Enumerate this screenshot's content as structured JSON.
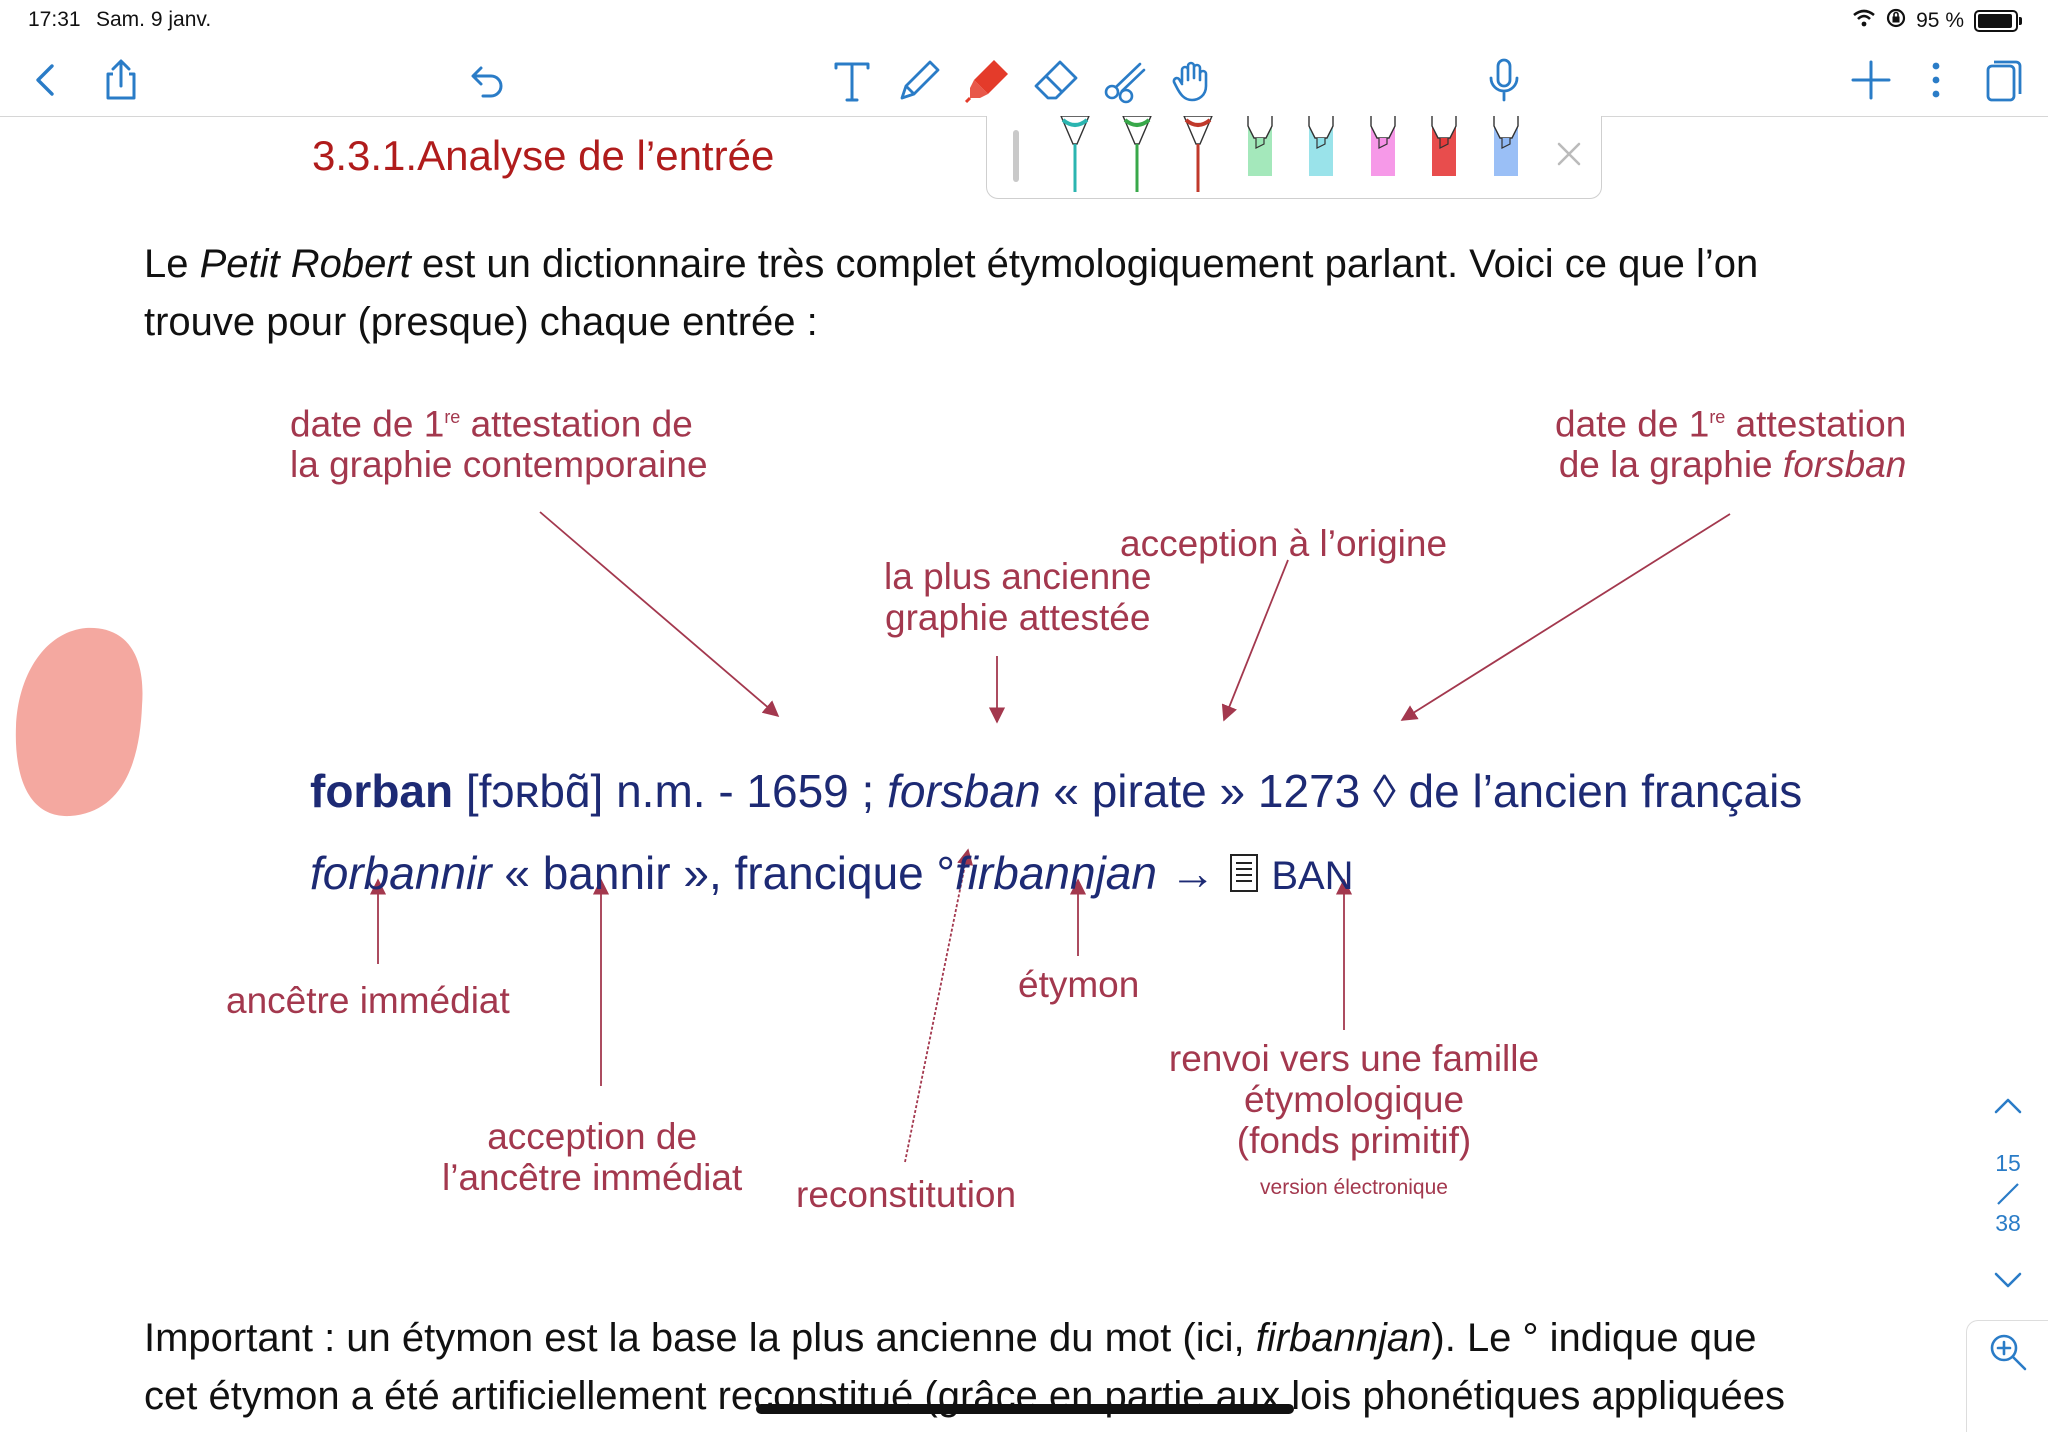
{
  "status_bar": {
    "time": "17:31",
    "date": "Sam. 9 janv.",
    "battery": "95 %"
  },
  "toolbar": {
    "left": [
      "back-icon",
      "share-icon",
      "undo-icon"
    ],
    "tools": [
      "text-tool-icon",
      "pen-tool-icon",
      "highlighter-tool-icon",
      "eraser-tool-icon",
      "lasso-tool-icon",
      "hand-tool-icon"
    ],
    "right": [
      "microphone-icon",
      "add-icon",
      "more-icon",
      "pages-icon"
    ]
  },
  "pen_tray": {
    "colors": [
      "#2bb5b0",
      "#38a84a",
      "#c0392b",
      "#9ae6b4",
      "#8fe0e8",
      "#f58ee6",
      "#e63a3a",
      "#8fb8f5"
    ]
  },
  "document": {
    "heading": "3.3.1.Analyse de l’entrée",
    "intro_1": "Le ",
    "intro_italic": "Petit Robert",
    "intro_2": " est un dictionnaire très complet étymologiquement parlant. Voici ce que l’on",
    "intro_3": "trouve pour (presque) chaque entrée :",
    "important_1": "Important : un étymon est la base la plus ancienne du mot (ici, ",
    "important_italic": "firbannjan",
    "important_2": "). Le ° indique que",
    "important_3": "cet étymon a été artificiellement reconstitué (grâce en partie aux lois phonétiques appliquées"
  },
  "figure": {
    "ann_date_contemp_1": "date de 1",
    "ann_date_contemp_sup": "re",
    "ann_date_contemp_2": " attestation de",
    "ann_date_contemp_3": "la graphie contemporaine",
    "ann_date_forsban_1": "date de 1",
    "ann_date_forsban_sup": "re",
    "ann_date_forsban_2": " attestation",
    "ann_date_forsban_3": "de la graphie ",
    "ann_date_forsban_italic": "forsban",
    "ann_plus_ancienne_1": "la plus ancienne",
    "ann_plus_ancienne_2": "graphie attestée",
    "ann_acception_origine": "acception à l’origine",
    "entry_word": "forban",
    "entry_line1_rest": " [fɔʀbɑ̃] n.m. - 1659 ; ",
    "entry_forsban": "forsban",
    "entry_line1_end": " « pirate » 1273 ◊ de l’ancien français",
    "entry_forbannir": "forbannir",
    "entry_line2_mid": " « bannir », francique °",
    "entry_firbannjan": "firbannjan",
    "entry_arrow": " → ",
    "entry_ban": "BAN",
    "ann_ancetre": "ancêtre immédiat",
    "ann_acception_ancetre_1": "acception de",
    "ann_acception_ancetre_2": "l’ancêtre immédiat",
    "ann_reconstitution": "reconstitution",
    "ann_etymon": "étymon",
    "ann_renvoi_1": "renvoi vers une famille",
    "ann_renvoi_2": "étymologique",
    "ann_renvoi_3": "(fonds primitif)",
    "ann_version": "version électronique"
  },
  "side_nav": {
    "current_page": "15",
    "total_pages": "38"
  },
  "colors": {
    "heading": "#b01c1c",
    "annotation": "#a3384e",
    "entry": "#1d2a74",
    "accent": "#2a7cc7",
    "blob": "#f4a8a0"
  }
}
